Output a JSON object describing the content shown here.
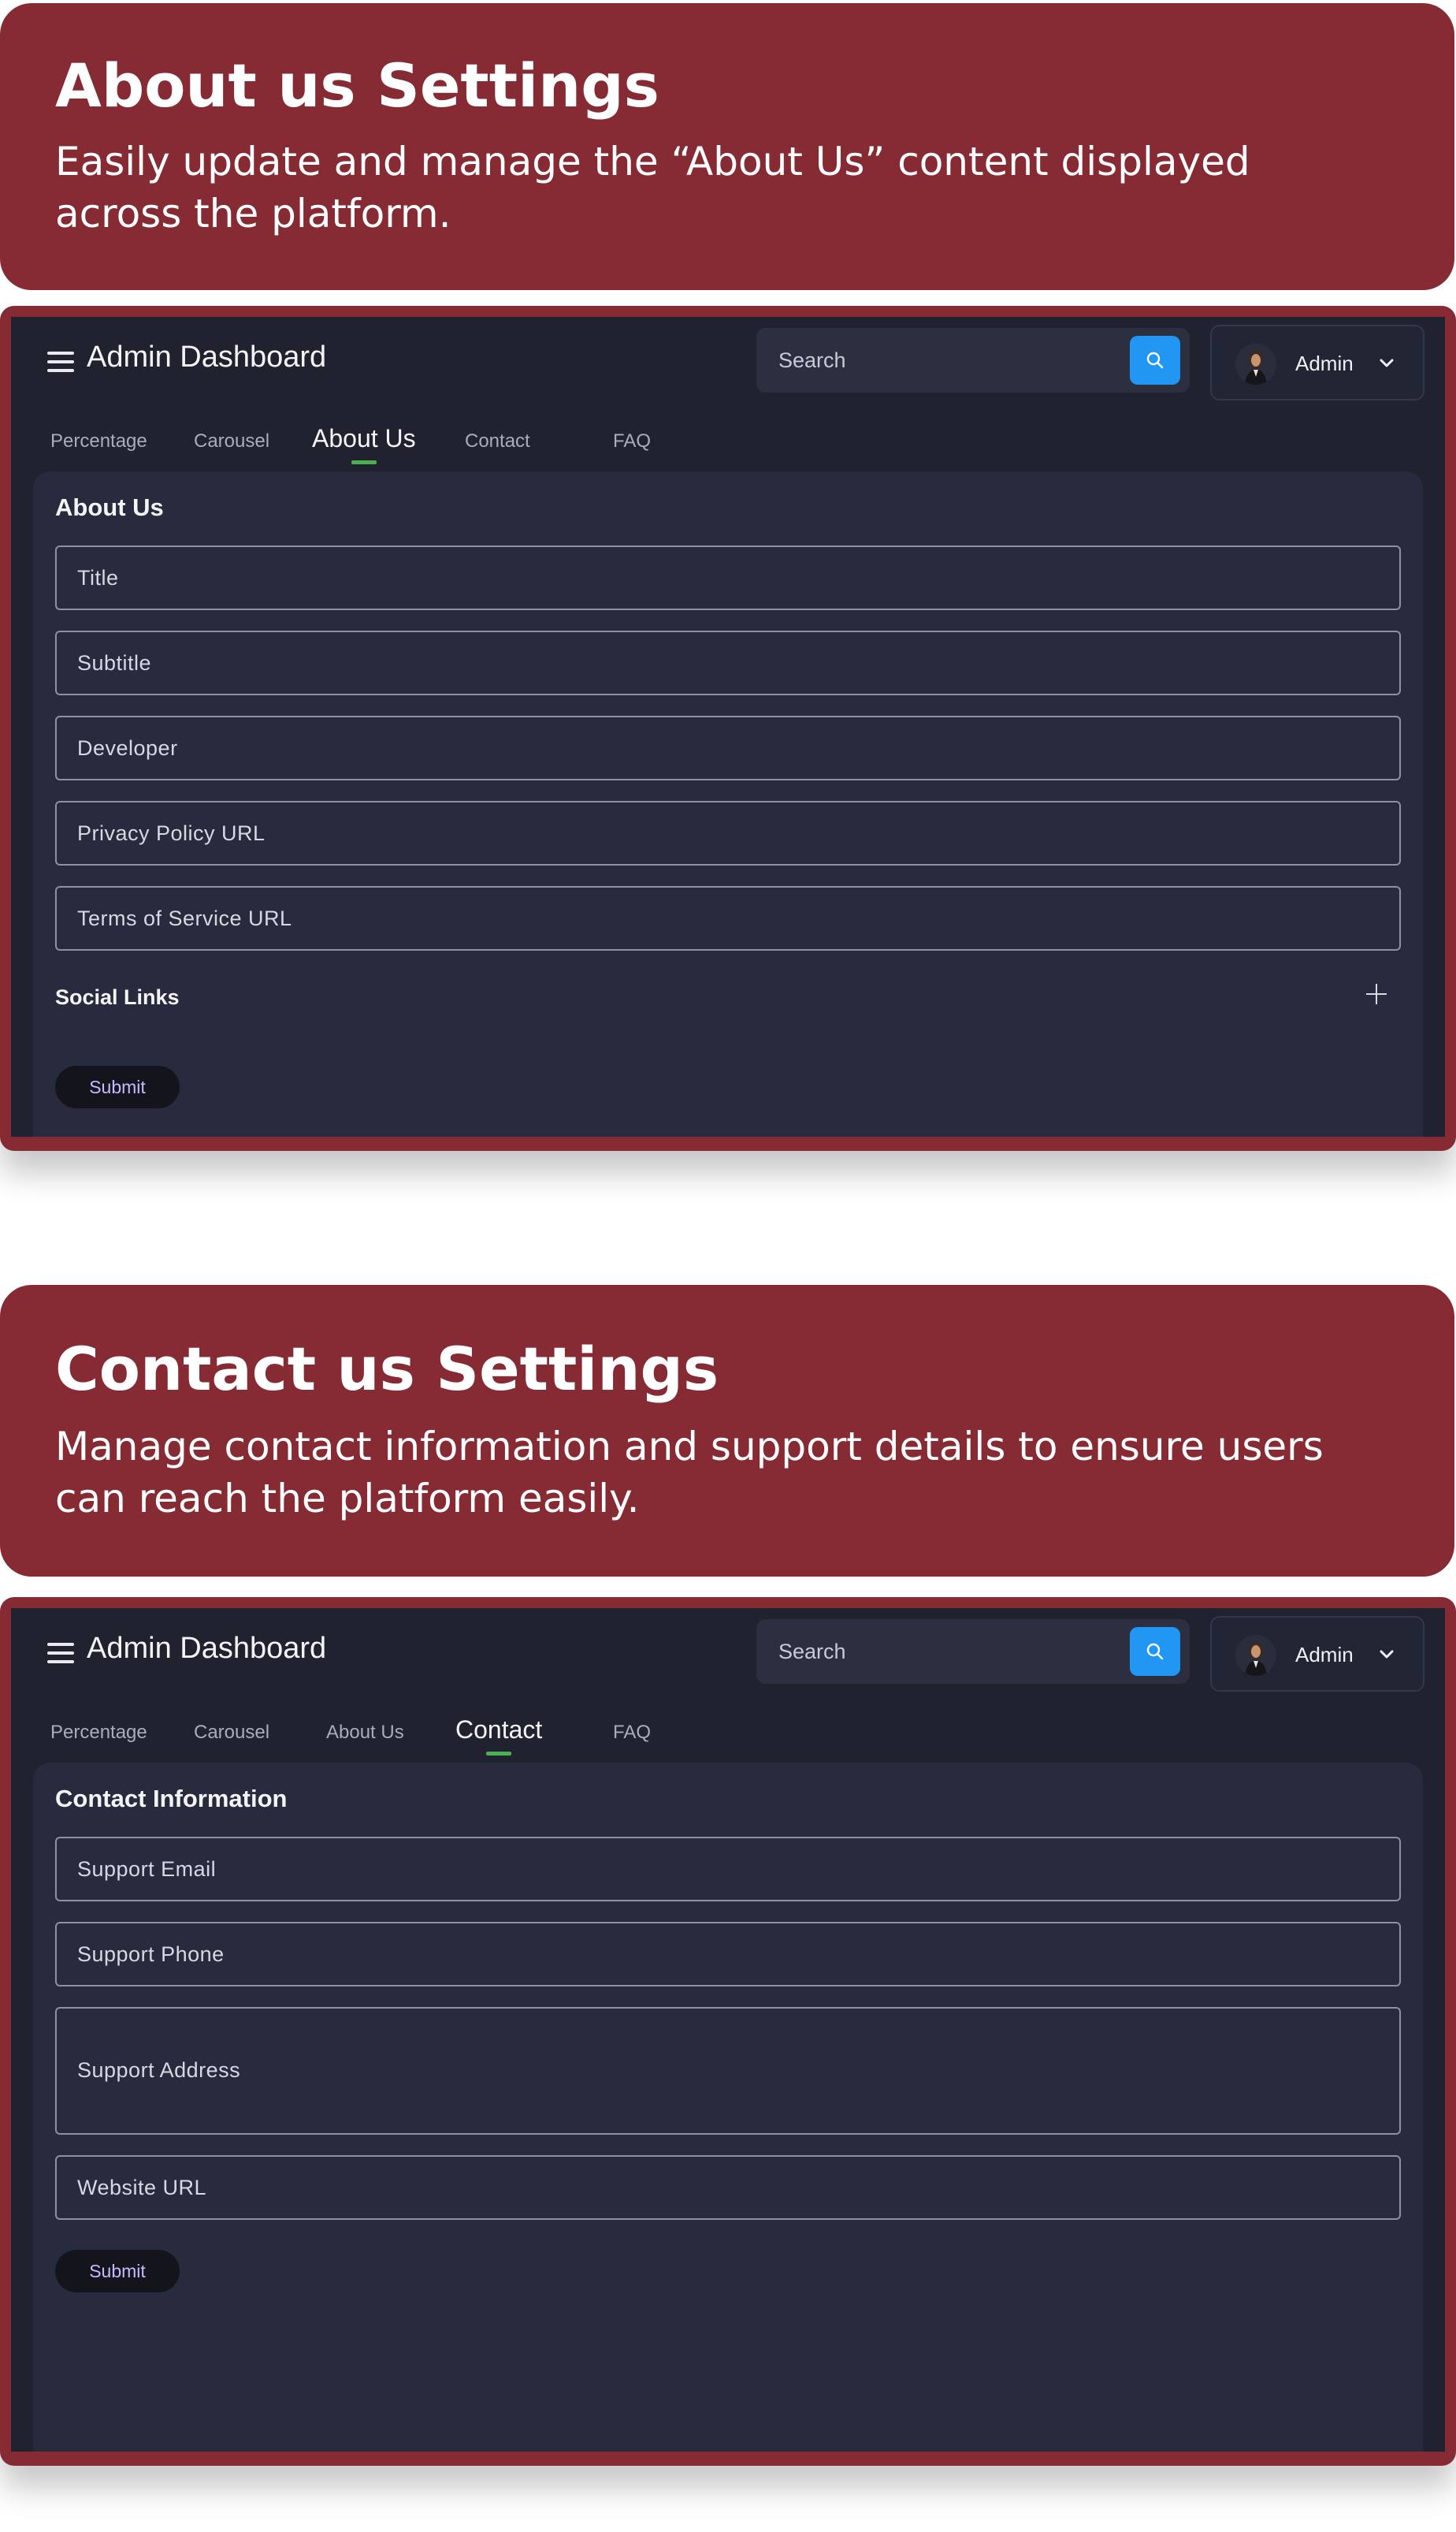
{
  "about_banner": {
    "title": "About us Settings",
    "description": "Easily update and manage the “About Us” content displayed across the platform."
  },
  "contact_banner": {
    "title": "Contact us Settings",
    "description": "Manage contact information and support details to ensure users can reach the platform easily."
  },
  "dashboard": {
    "app_title": "Admin Dashboard",
    "search_placeholder": "Search",
    "user_label": "Admin",
    "tabs": [
      "Percentage",
      "Carousel",
      "About Us",
      "Contact",
      "FAQ"
    ]
  },
  "about_screen": {
    "active_tab": "About Us",
    "section_title": "About Us",
    "fields": [
      "Title",
      "Subtitle",
      "Developer",
      "Privacy Policy URL",
      "Terms of Service URL"
    ],
    "social_links_title": "Social Links",
    "submit_label": "Submit"
  },
  "contact_screen": {
    "active_tab": "Contact",
    "section_title": "Contact Information",
    "fields": [
      "Support Email",
      "Support Phone",
      "Support Address",
      "Website URL"
    ],
    "submit_label": "Submit"
  },
  "colors": {
    "banner": "#862a33",
    "background": "#20222f",
    "card": "#282b3e",
    "accent_blue": "#2196f3",
    "tab_indicator": "#4caf50"
  },
  "icons": [
    "menu-icon",
    "search-icon",
    "avatar",
    "chevron-down-icon",
    "plus-icon"
  ]
}
